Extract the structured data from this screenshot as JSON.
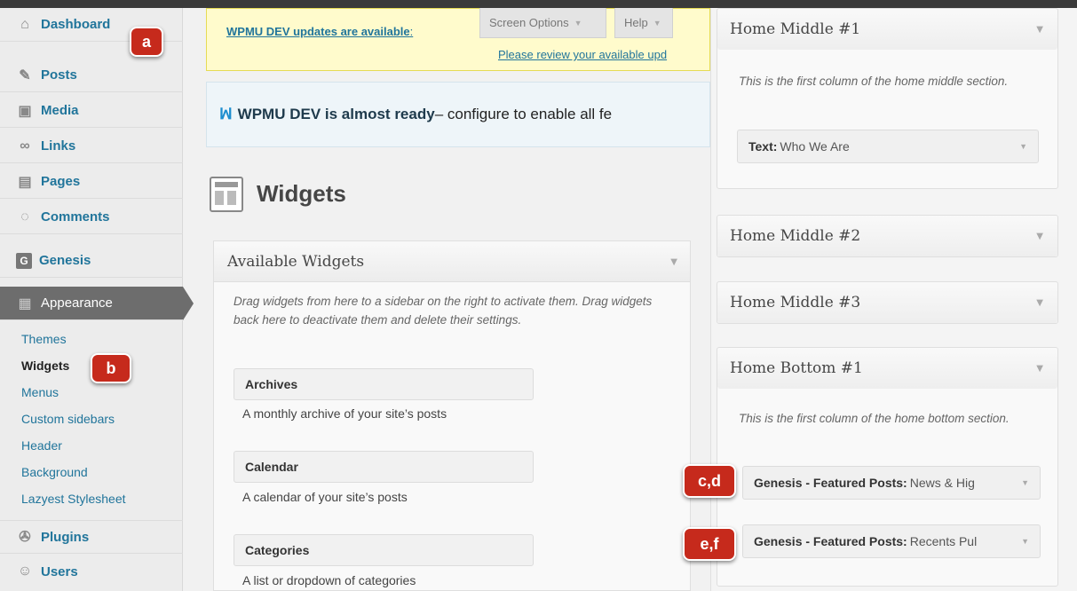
{
  "sidebar": {
    "items": [
      {
        "label": "Dashboard",
        "icon": "home-icon",
        "glyph": "⌂"
      },
      {
        "label": "Posts",
        "icon": "pushpin-icon",
        "glyph": "✎"
      },
      {
        "label": "Media",
        "icon": "media-icon",
        "glyph": "▣"
      },
      {
        "label": "Links",
        "icon": "link-icon",
        "glyph": "∞"
      },
      {
        "label": "Pages",
        "icon": "pages-icon",
        "glyph": "▤"
      },
      {
        "label": "Comments",
        "icon": "comment-icon",
        "glyph": "◌"
      },
      {
        "label": "Genesis",
        "icon": "genesis-icon",
        "glyph": "G"
      },
      {
        "label": "Appearance",
        "icon": "appearance-icon",
        "glyph": "▦"
      },
      {
        "label": "Plugins",
        "icon": "plugin-icon",
        "glyph": "✇"
      },
      {
        "label": "Users",
        "icon": "users-icon",
        "glyph": "☺"
      }
    ],
    "submenu": [
      "Themes",
      "Widgets",
      "Menus",
      "Custom sidebars",
      "Header",
      "Background",
      "Lazyest Stylesheet"
    ]
  },
  "badges": {
    "a": "a",
    "b": "b",
    "cd": "c,d",
    "ef": "e,f"
  },
  "notice": {
    "updates_link": "WPMU DEV updates are available",
    "updates_colon": ":",
    "review_link": "Please review your available upd"
  },
  "tabs": {
    "screen_options": "Screen Options",
    "help": "Help"
  },
  "ready": {
    "bold": "WPMU DEV is almost ready",
    "rest": " – configure to enable all fe"
  },
  "page_title": "Widgets",
  "available": {
    "title": "Available Widgets",
    "description": "Drag widgets from here to a sidebar on the right to activate them. Drag widgets back here to deactivate them and delete their settings.",
    "widgets": [
      {
        "name": "Archives",
        "desc": "A monthly archive of your site’s posts"
      },
      {
        "name": "Calendar",
        "desc": "A calendar of your site’s posts"
      },
      {
        "name": "Categories",
        "desc": "A list or dropdown of categories"
      }
    ]
  },
  "sidebars": {
    "home_middle_1": {
      "title": "Home Middle #1",
      "desc": "This is the first column of the home middle section.",
      "widget_type": "Text:",
      "widget_title": "Who We Are"
    },
    "home_middle_2": {
      "title": "Home Middle #2"
    },
    "home_middle_3": {
      "title": "Home Middle #3"
    },
    "home_bottom_1": {
      "title": "Home Bottom #1",
      "desc": "This is the first column of the home bottom section.",
      "widgets": [
        {
          "type": "Genesis - Featured Posts:",
          "title": "News & Hig"
        },
        {
          "type": "Genesis - Featured Posts:",
          "title": "Recents Pul"
        }
      ]
    }
  },
  "colors": {
    "link": "#21759b",
    "badge": "#c62a1c",
    "notice_bg": "#fffbcc",
    "active_menu": "#6d6d6d"
  }
}
